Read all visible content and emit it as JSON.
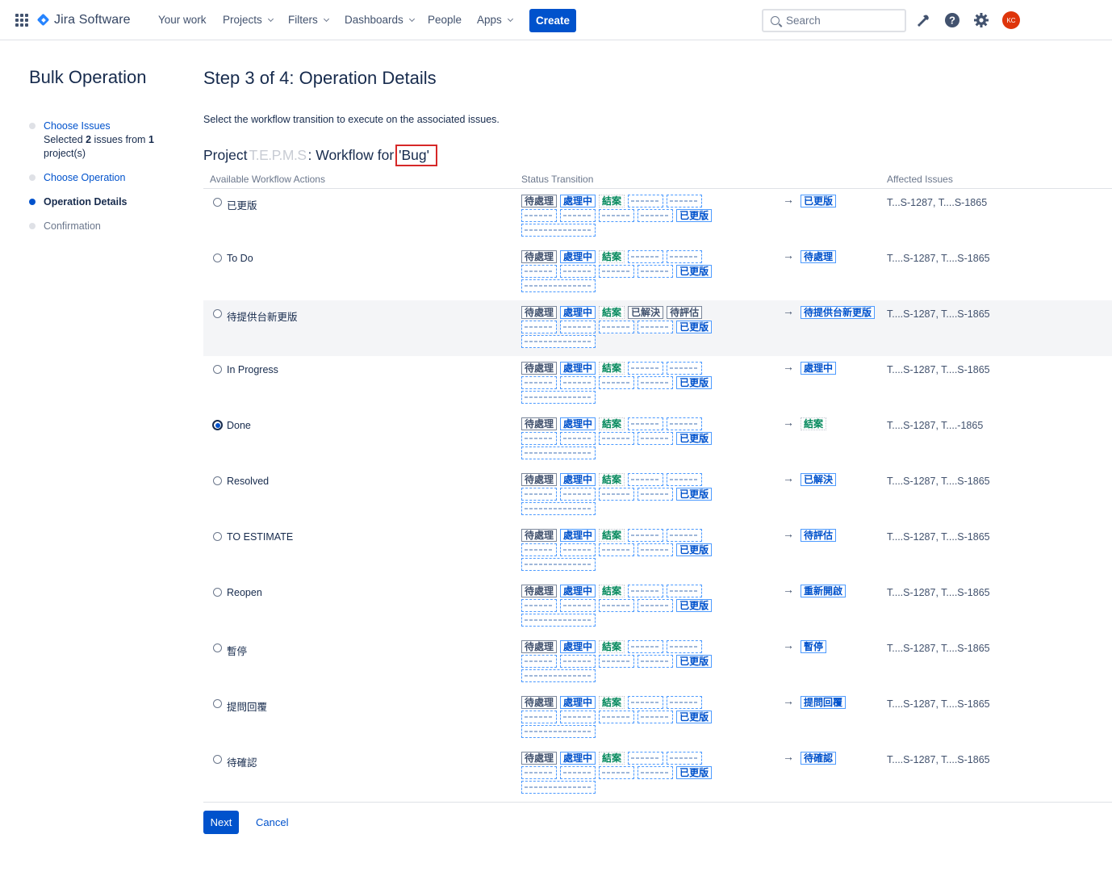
{
  "nav": {
    "app_name": "Jira Software",
    "items": [
      "Your work",
      "Projects",
      "Filters",
      "Dashboards",
      "People",
      "Apps"
    ],
    "create_label": "Create",
    "search_placeholder": "Search",
    "avatar_initials": "KC"
  },
  "sidebar": {
    "title": "Bulk Operation",
    "steps": [
      {
        "label": "Choose Issues",
        "detail_pre": "Selected ",
        "detail_count": "2",
        "detail_mid": " issues from ",
        "detail_projects": "1",
        "detail_post": "project(s)"
      },
      {
        "label": "Choose Operation"
      },
      {
        "label": "Operation Details"
      },
      {
        "label": "Confirmation"
      }
    ]
  },
  "main": {
    "title": "Step 3 of 4: Operation Details",
    "instructions": "Select the workflow transition to execute on the associated issues.",
    "project_prefix": "Project",
    "project_name": "T.E.P.M.S",
    "workflow_label": ": Workflow for",
    "issue_type": "'Bug'",
    "columns": [
      "Available Workflow Actions",
      "Status Transition",
      "Affected Issues"
    ],
    "statuses": {
      "todo": "待處理",
      "inprogress": "處理中",
      "done": "結案",
      "resolved": "已解決",
      "estimate": "待評估",
      "released": "已更版",
      "pending": "待提供台新更版"
    },
    "rows": [
      {
        "action": "已更版",
        "target": "已更版",
        "affected": "T...S-1287, T....S-1865"
      },
      {
        "action": "To Do",
        "target": "待處理",
        "affected": "T....S-1287, T....S-1865"
      },
      {
        "action": "待提供台新更版",
        "target": "待提供台新更版",
        "affected": "T....S-1287, T....S-1865"
      },
      {
        "action": "In Progress",
        "target": "處理中",
        "affected": "T....S-1287, T....S-1865"
      },
      {
        "action": "Done",
        "target": "結案",
        "affected": "T....S-1287, T....-1865"
      },
      {
        "action": "Resolved",
        "target": "已解決",
        "affected": "T....S-1287, T....S-1865"
      },
      {
        "action": "TO ESTIMATE",
        "target": "待評估",
        "affected": "T....S-1287, T....S-1865"
      },
      {
        "action": "Reopen",
        "target": "重新開啟",
        "affected": "T....S-1287, T....S-1865"
      },
      {
        "action": "暫停",
        "target": "暫停",
        "affected": "T....S-1287, T....S-1865"
      },
      {
        "action": "提問回覆",
        "target": "提問回覆",
        "affected": "T....S-1287, T....S-1865"
      },
      {
        "action": "待確認",
        "target": "待確認",
        "affected": "T....S-1287, T....S-1865"
      }
    ]
  },
  "footer": {
    "next_label": "Next",
    "cancel_label": "Cancel"
  }
}
